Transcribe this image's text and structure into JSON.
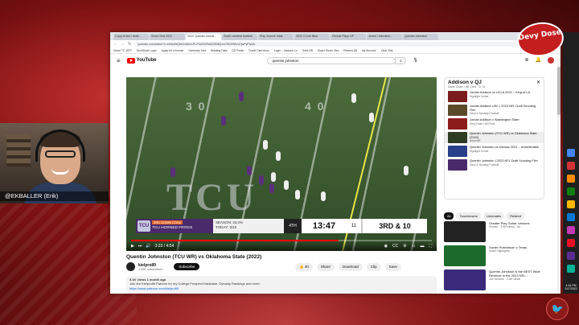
{
  "overlay": {
    "brand": "Devy Dose",
    "webcam_label": "@EKBALLER (Erik)"
  },
  "browser": {
    "tabs": [
      "Copy of dev / draft...",
      "Scout Grid 2022",
      "2022 Quentin Johnst...",
      "South carolina football",
      "Play 'scores' stats",
      "2022 2-Line Blue",
      "Dennis Plays UP",
      "Jones / Johnston...",
      "Quentin Johnston"
    ],
    "url": "youtube.com/watch?v=eI0AaNQbbVc&list=PLF0cf2W9d4ZZfN8QXnT5DZWhrLEjwPyPfyOb",
    "bookmarks": [
      "Home TC-WTF",
      "DuckDuck Login",
      "Apply for a license",
      "Summary Grid",
      "Building Data",
      "DD Portal",
      "Credit Card Acco",
      "Login – Jackson Lu",
      "Sells DB",
      "Super Room Xtra",
      "Reseed (8)",
      "My Account",
      "Xbox Vids"
    ]
  },
  "youtube": {
    "search_value": "quentin johnston",
    "video": {
      "title": "Quentin Johnston (TCU WR) vs Oklahoma State (2022)",
      "time": "3:23 / 4:54",
      "progress": 0.69,
      "field_text": "TCU",
      "yard_numbers": [
        "3 0",
        "4 0"
      ]
    },
    "scorebug": {
      "team_tag": "3RD DOWN CONV",
      "team_name": "TCU HORNED FROGS",
      "logo_text": "TCU",
      "stat1": "SEASON: 43.2%",
      "stat2": "TODAY: 3/10",
      "quarter": "4TH",
      "clock": "13:47",
      "timeouts": "11",
      "down": "3RD & 10"
    },
    "channel": {
      "name": "kielpro89",
      "subs": "1.59K subscribers",
      "subscribe": "Subscribe"
    },
    "actions": [
      "40",
      "Share",
      "Download",
      "Clip",
      "Save"
    ],
    "description": {
      "views": "5.1K views  1 month ago",
      "line1": "Join the Kielpro89 Patreon for my College Prospect Database, Dynasty Rankings and more:",
      "link": "https://www.patreon.com/kielpro89"
    },
    "playlist": {
      "title": "Addison v QJ",
      "subtitle": "Dave Dose / 66 Cruz · 6 / 6",
      "items": [
        {
          "title": "Jordan Addison vs UCLA 2022 – King of LA",
          "meta": "Highlight Center",
          "color": "#7b1c1c"
        },
        {
          "title": "Jordan Addison USC | 2023 NFL Draft Scouting Film",
          "meta": "Dave & Dynasty Football",
          "color": "#5a4a2a"
        },
        {
          "title": "Jordan Addison v Washington State",
          "meta": "Devy Dose / 66 Films",
          "color": "#8b1a1a"
        },
        {
          "title": "Quentin Johnston (TCU WR) vs Oklahoma State (2022)",
          "meta": "kielpro89",
          "color": "#2e3c24"
        },
        {
          "title": "Quentin Johnston vs Kansas 2022 – Unbelievable",
          "meta": "Highlight Center",
          "color": "#2a3f8a"
        },
        {
          "title": "Quentin Johnston | 2023 NFL Draft Scouting Film",
          "meta": "Dave & Dynasty Football",
          "color": "#4b2a6b"
        }
      ]
    },
    "chips": [
      "All",
      "Touchdowns",
      "Linemates",
      "Related"
    ],
    "recommendations": [
      {
        "title": "Greater Play Guitar Lessons",
        "meta": "Fender · 3.9M views · Ad",
        "color": "#222"
      },
      {
        "title": "Xavier Hutchinson v Texas",
        "meta": "Hutch Highlights",
        "color": "#1c6b2c"
      },
      {
        "title": "Quentin Johnston is the BEST Wide Receiver in the 2023 NFL...",
        "meta": "Joe Gridiron · 2.8K views",
        "color": "#3a2a7a"
      }
    ]
  },
  "taskbar": {
    "time": "4:44 PM",
    "date": "11/7/2022",
    "icon_colors": [
      "#4285f4",
      "#d13438",
      "#ff8c00",
      "#107c10",
      "#ffb900",
      "#0078d4",
      "#c239b3",
      "#e81123",
      "#5c2d91",
      "#00b294"
    ]
  }
}
